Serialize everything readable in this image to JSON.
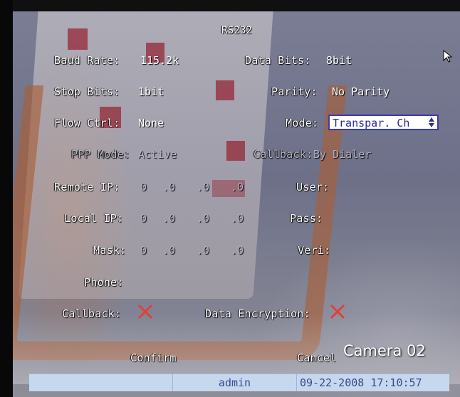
{
  "dialog": {
    "title": "RS232",
    "fields": {
      "baud_rate_label": "Baud Rate:",
      "baud_rate_value": "115.2k",
      "data_bits_label": "Data Bits:",
      "data_bits_value": "8bit",
      "stop_bits_label": "Stop Bits:",
      "stop_bits_value": "1bit",
      "parity_label": "Parity:",
      "parity_value": "No Parity",
      "flow_ctrl_label": "Flow Ctrl:",
      "flow_ctrl_value": "None",
      "mode_label": "Mode:",
      "mode_value": "Transpar. Ch",
      "ppp_mode_label": "PPP Mode:",
      "ppp_mode_value": "Active",
      "callback_mode_label": "Callback:",
      "callback_mode_value": "By Dialer",
      "remote_ip_label": "Remote IP:",
      "remote_ip": [
        "0",
        "0",
        "0",
        "0"
      ],
      "user_label": "User:",
      "local_ip_label": "Local IP:",
      "local_ip": [
        "0",
        "0",
        "0",
        "0"
      ],
      "pass_label": "Pass:",
      "mask_label": "Mask:",
      "mask": [
        "0",
        "0",
        "0",
        "0"
      ],
      "veri_label": "Veri:",
      "phone_label": "Phone:",
      "callback_label": "Callback:",
      "data_encryption_label": "Data Encryption:"
    },
    "ip_separator": ".",
    "confirm_label": "Confirm",
    "cancel_label": "Cancel"
  },
  "camera_label": "Camera 02",
  "status_bar": {
    "user": "admin",
    "datetime": "09-22-2008 17:10:57"
  },
  "icons": {
    "unchecked": "red-x-icon",
    "select_arrows": "up-down-arrows-icon",
    "cursor": "mouse-pointer-icon"
  },
  "colors": {
    "unchecked_x": "#e0403a",
    "select_border": "#3a3ab0",
    "select_text": "#2a2aa0",
    "status_bar_bg": "#c5d9ee",
    "status_text": "#3a4a8a"
  }
}
